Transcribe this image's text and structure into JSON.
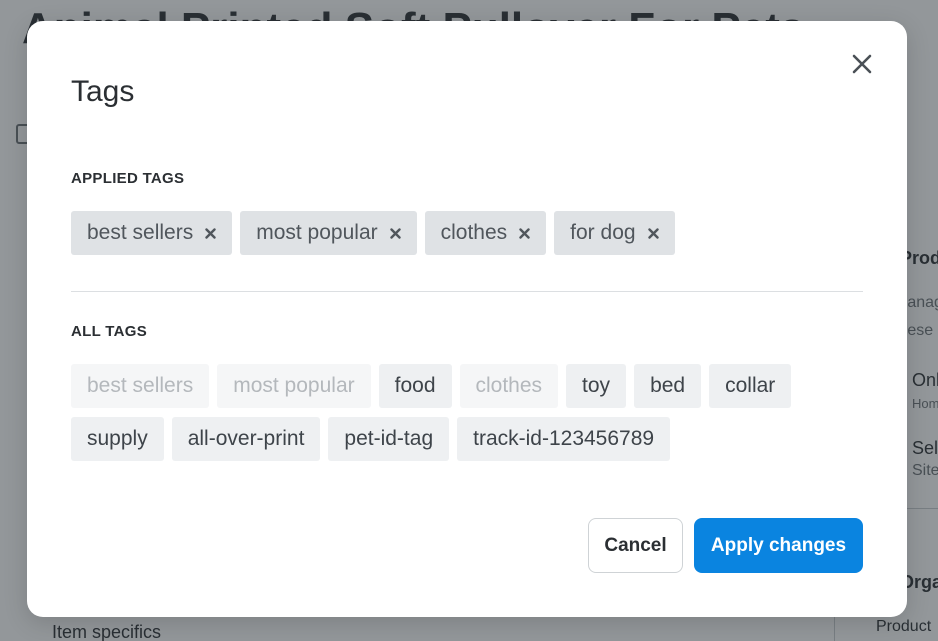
{
  "background": {
    "title": "Animal Printed Soft Pullover For Pets",
    "right_panel_heading": "Product",
    "right_panel_line1": "Manage",
    "right_panel_line2": "these c",
    "right_option_1": "Online",
    "right_option_1_sub": "Home",
    "right_option_2": "Sell",
    "right_option_2_sub": "Site",
    "right_section": "Organ",
    "right_product_label": "Product",
    "item_specifics": "Item specifics"
  },
  "modal": {
    "title": "Tags",
    "close_icon": "close-icon",
    "applied_label": "APPLIED TAGS",
    "all_label": "ALL TAGS",
    "applied_tags": [
      {
        "label": "best sellers"
      },
      {
        "label": "most popular"
      },
      {
        "label": "clothes"
      },
      {
        "label": "for dog"
      }
    ],
    "all_tags": [
      {
        "label": "best sellers",
        "state": "applied"
      },
      {
        "label": "most popular",
        "state": "applied"
      },
      {
        "label": "food",
        "state": "available"
      },
      {
        "label": "clothes",
        "state": "applied"
      },
      {
        "label": "toy",
        "state": "available"
      },
      {
        "label": "bed",
        "state": "available"
      },
      {
        "label": "collar",
        "state": "available"
      },
      {
        "label": "supply",
        "state": "available"
      },
      {
        "label": "all-over-print",
        "state": "available"
      },
      {
        "label": "pet-id-tag",
        "state": "available"
      },
      {
        "label": "track-id-123456789",
        "state": "available"
      }
    ],
    "cancel_label": "Cancel",
    "apply_label": "Apply changes"
  },
  "colors": {
    "primary": "#0a84e0",
    "chip_applied_bg": "#dfe2e5",
    "chip_available_bg": "#eef0f2",
    "chip_disabled_text": "#b4b8bc",
    "overlay": "rgba(40,48,54,0.5)"
  }
}
